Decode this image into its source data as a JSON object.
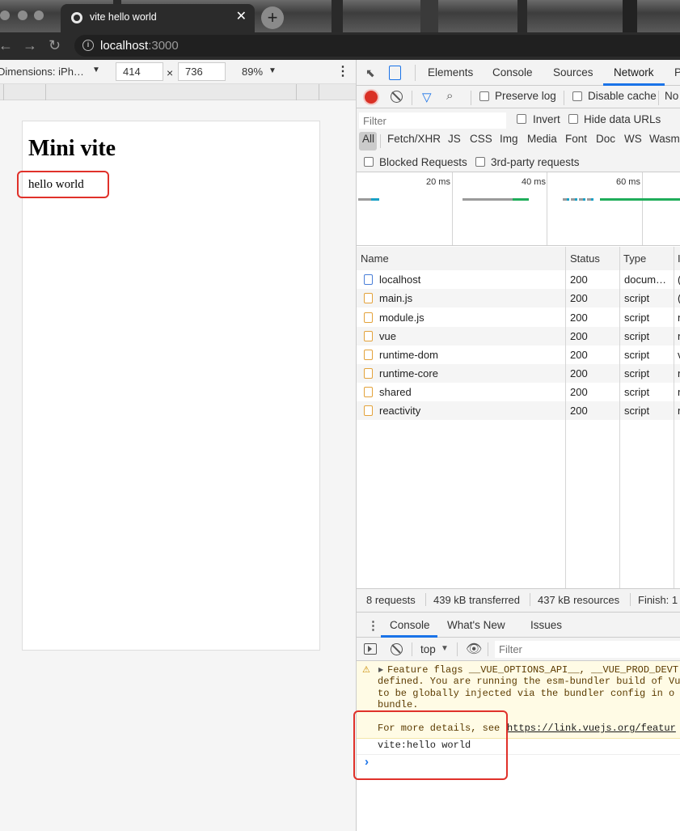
{
  "browser": {
    "tab_title": "vite hello world",
    "tab_close": "✕",
    "new_tab": "+",
    "url_host": "localhost",
    "url_port": ":3000"
  },
  "device_toolbar": {
    "dimensions_label": "Dimensions: iPh…",
    "width": "414",
    "height": "736",
    "times": "×",
    "zoom": "89%"
  },
  "page": {
    "heading": "Mini vite",
    "text": "hello world"
  },
  "devtools": {
    "tabs": [
      "Elements",
      "Console",
      "Sources",
      "Network",
      "P"
    ],
    "network_toolbar": {
      "preserve_log": "Preserve log",
      "disable_cache": "Disable cache",
      "throttle": "No"
    },
    "filter": {
      "placeholder": "Filter",
      "invert": "Invert",
      "hide_data_urls": "Hide data URLs"
    },
    "types": [
      "All",
      "Fetch/XHR",
      "JS",
      "CSS",
      "Img",
      "Media",
      "Font",
      "Doc",
      "WS",
      "Wasm"
    ],
    "blocked_requests": "Blocked Requests",
    "third_party": "3rd-party requests",
    "timeline_labels": [
      "20 ms",
      "40 ms",
      "60 ms"
    ],
    "columns": [
      "Name",
      "Status",
      "Type",
      "I"
    ],
    "rows": [
      {
        "name": "localhost",
        "status": "200",
        "type": "docum…",
        "init": "(",
        "doc": true
      },
      {
        "name": "main.js",
        "status": "200",
        "type": "script",
        "init": "("
      },
      {
        "name": "module.js",
        "status": "200",
        "type": "script",
        "init": "n"
      },
      {
        "name": "vue",
        "status": "200",
        "type": "script",
        "init": "n"
      },
      {
        "name": "runtime-dom",
        "status": "200",
        "type": "script",
        "init": "v"
      },
      {
        "name": "runtime-core",
        "status": "200",
        "type": "script",
        "init": "n"
      },
      {
        "name": "shared",
        "status": "200",
        "type": "script",
        "init": "n"
      },
      {
        "name": "reactivity",
        "status": "200",
        "type": "script",
        "init": "n"
      }
    ],
    "summary": {
      "requests": "8 requests",
      "transferred": "439 kB transferred",
      "resources": "437 kB resources",
      "finish": "Finish: 1"
    },
    "drawer_tabs": [
      "Console",
      "What's New",
      "Issues"
    ],
    "console_toolbar": {
      "context": "top",
      "filter_placeholder": "Filter"
    },
    "warning_lines": [
      "Feature flags __VUE_OPTIONS_API__, __VUE_PROD_DEVT",
      "defined. You are running the esm-bundler build of Vu",
      "to be globally injected via the bundler config in o",
      "bundle.",
      "",
      "For more details, see "
    ],
    "warning_link": "https://link.vuejs.org/featur",
    "log_message": "vite:hello world",
    "prompt": "›"
  },
  "colors": {
    "accent": "#1a73e8",
    "highlight": "#e0312a",
    "record": "#d93025"
  }
}
